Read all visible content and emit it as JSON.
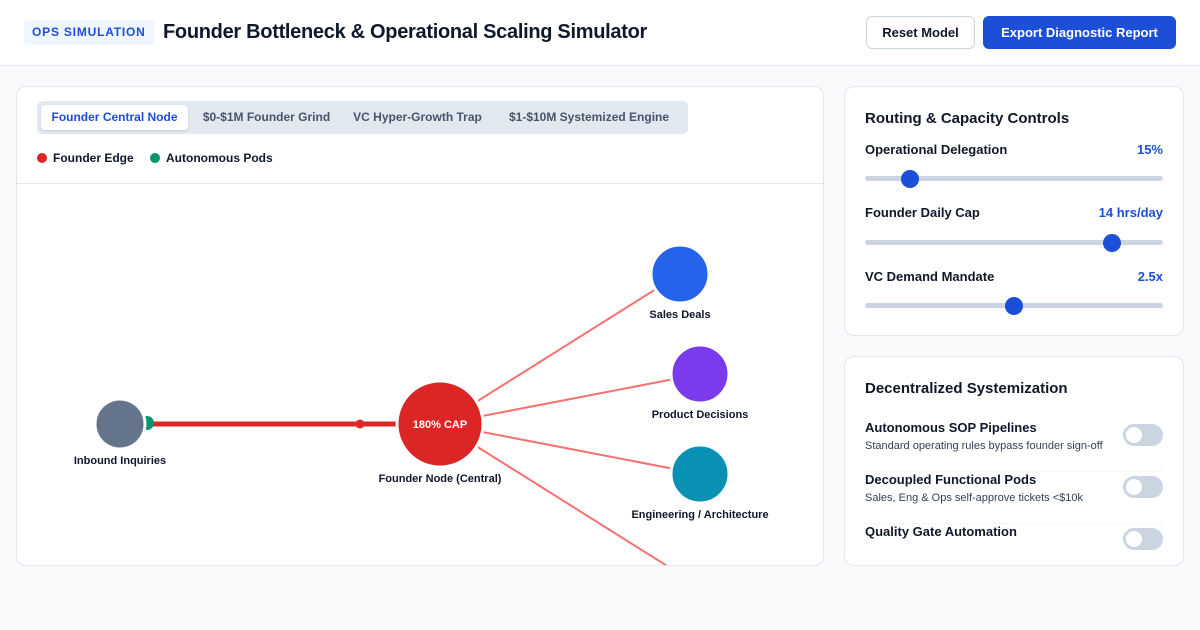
{
  "header": {
    "badge": "OPS SIMULATION",
    "title": "Founder Bottleneck & Operational Scaling Simulator",
    "reset_label": "Reset Model",
    "export_label": "Export Diagnostic Report"
  },
  "viz": {
    "tabs": [
      {
        "label": "Founder Central Node",
        "active": true
      },
      {
        "label": "$0-$1M Founder Grind",
        "active": false
      },
      {
        "label": "VC Hyper-Growth Trap",
        "active": false
      },
      {
        "label": "$1-$10M Systemized Engine",
        "active": false
      }
    ],
    "legend": [
      {
        "label": "Founder Edge",
        "color": "#dc2626"
      },
      {
        "label": "Autonomous Pods",
        "color": "#059669"
      }
    ],
    "nodes": {
      "inbound": {
        "label": "Inbound Inquiries",
        "color": "#64748b"
      },
      "founder": {
        "label": "Founder Node (Central)",
        "center_text": "180% CAP",
        "color": "#dc2626"
      },
      "sales": {
        "label": "Sales Deals",
        "color": "#2563eb"
      },
      "product": {
        "label": "Product Decisions",
        "color": "#7c3aed"
      },
      "engineering": {
        "label": "Engineering / Architecture",
        "color": "#0891b2"
      }
    },
    "edge_colors": {
      "inbound_edge": "#dc2626",
      "outbound_edge": "#f87171"
    }
  },
  "controls": {
    "title": "Routing & Capacity Controls",
    "sliders": [
      {
        "label": "Operational Delegation",
        "value_text": "15%",
        "fraction": 0.15
      },
      {
        "label": "Founder Daily Cap",
        "value_text": "14 hrs/day",
        "fraction": 0.83
      },
      {
        "label": "VC Demand Mandate",
        "value_text": "2.5x",
        "fraction": 0.5
      }
    ]
  },
  "systemization": {
    "title": "Decentralized Systemization",
    "toggles": [
      {
        "title": "Autonomous SOP Pipelines",
        "desc": "Standard operating rules bypass founder sign-off",
        "on": false
      },
      {
        "title": "Decoupled Functional Pods",
        "desc": "Sales, Eng & Ops self-approve tickets <$10k",
        "on": false
      },
      {
        "title": "Quality Gate Automation",
        "desc": "",
        "on": false
      }
    ]
  }
}
